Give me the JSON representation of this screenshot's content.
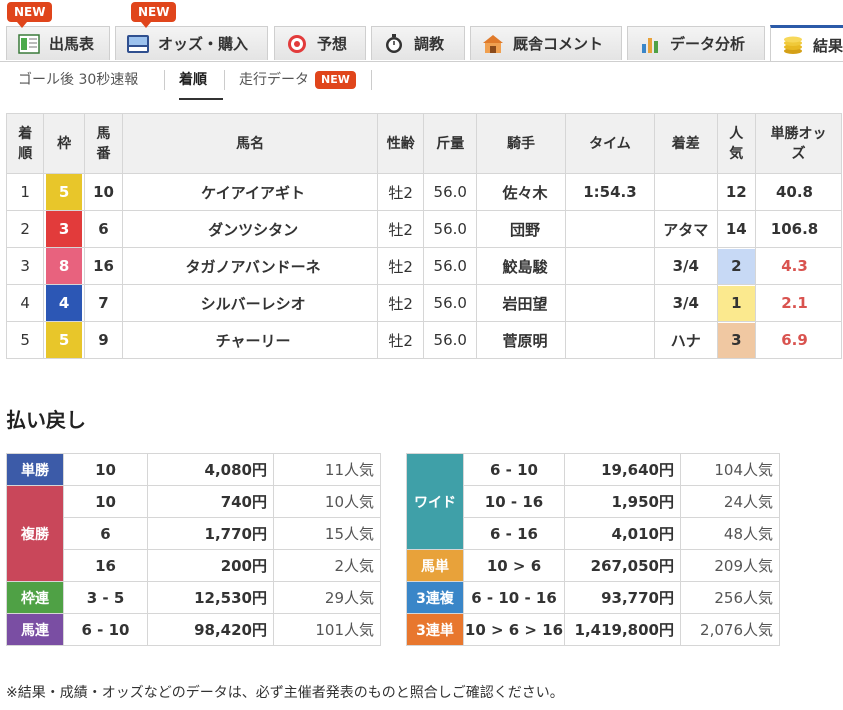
{
  "tabs": [
    {
      "label": "出馬表",
      "icon": "entries-table-icon",
      "new": true
    },
    {
      "label": "オッズ・購入",
      "icon": "ipat-odds-icon",
      "new": true
    },
    {
      "label": "予想",
      "icon": "target-icon",
      "new": false
    },
    {
      "label": "調教",
      "icon": "stopwatch-icon",
      "new": false
    },
    {
      "label": "厩舎コメント",
      "icon": "stable-icon",
      "new": false
    },
    {
      "label": "データ分析",
      "icon": "bar-chart-icon",
      "new": false
    },
    {
      "label": "結果",
      "icon": "coins-icon",
      "new": false,
      "active": true
    }
  ],
  "new_label": "NEW",
  "subnav": {
    "items": [
      "ゴール後 30秒速報",
      "着順",
      "走行データ"
    ],
    "active_index": 1,
    "new_on_index": 2
  },
  "results": {
    "headers": {
      "rank": "着順",
      "frame": "枠",
      "number": "馬番",
      "horse": "馬名",
      "sexage": "性齢",
      "weight": "斤量",
      "jockey": "騎手",
      "time": "タイム",
      "margin": "着差",
      "popularity": "人気",
      "odds": "単勝オッズ"
    },
    "rows": [
      {
        "rank": "1",
        "frame": "5",
        "frame_color": "#e8c62a",
        "number": "10",
        "horse": "ケイアイアギト",
        "sexage": "牡2",
        "weight": "56.0",
        "jockey": "佐々木",
        "time": "1:54.3",
        "margin": "",
        "popularity": "12",
        "pop_bg": "",
        "odds": "40.8",
        "odds_color": "#333333"
      },
      {
        "rank": "2",
        "frame": "3",
        "frame_color": "#e23b3b",
        "number": "6",
        "horse": "ダンツシタン",
        "sexage": "牡2",
        "weight": "56.0",
        "jockey": "団野",
        "time": "",
        "margin": "アタマ",
        "popularity": "14",
        "pop_bg": "",
        "odds": "106.8",
        "odds_color": "#333333"
      },
      {
        "rank": "3",
        "frame": "8",
        "frame_color": "#e8627e",
        "number": "16",
        "horse": "タガノアバンドーネ",
        "sexage": "牡2",
        "weight": "56.0",
        "jockey": "鮫島駿",
        "time": "",
        "margin": "3/4",
        "popularity": "2",
        "pop_bg": "#c7d9f5",
        "odds": "4.3",
        "odds_color": "#d9534f"
      },
      {
        "rank": "4",
        "frame": "4",
        "frame_color": "#2c57b5",
        "number": "7",
        "horse": "シルバーレシオ",
        "sexage": "牡2",
        "weight": "56.0",
        "jockey": "岩田望",
        "time": "",
        "margin": "3/4",
        "popularity": "1",
        "pop_bg": "#fbe98e",
        "odds": "2.1",
        "odds_color": "#d9534f"
      },
      {
        "rank": "5",
        "frame": "5",
        "frame_color": "#e8c62a",
        "number": "9",
        "horse": "チャーリー",
        "sexage": "牡2",
        "weight": "56.0",
        "jockey": "菅原明",
        "time": "",
        "margin": "ハナ",
        "popularity": "3",
        "pop_bg": "#f0c8a2",
        "odds": "6.9",
        "odds_color": "#d9534f"
      }
    ]
  },
  "payout": {
    "title": "払い戻し",
    "left": [
      {
        "label": "単勝",
        "color": "#3c5ba8",
        "entries": [
          {
            "combo": "10",
            "amount": "4,080円",
            "pop": "11人気"
          }
        ]
      },
      {
        "label": "複勝",
        "color": "#c9475a",
        "entries": [
          {
            "combo": "10",
            "amount": "740円",
            "pop": "10人気"
          },
          {
            "combo": "6",
            "amount": "1,770円",
            "pop": "15人気"
          },
          {
            "combo": "16",
            "amount": "200円",
            "pop": "2人気"
          }
        ]
      },
      {
        "label": "枠連",
        "color": "#4fa145",
        "entries": [
          {
            "combo": "3 - 5",
            "amount": "12,530円",
            "pop": "29人気"
          }
        ]
      },
      {
        "label": "馬連",
        "color": "#7a4ea3",
        "entries": [
          {
            "combo": "6 - 10",
            "amount": "98,420円",
            "pop": "101人気"
          }
        ]
      }
    ],
    "right": [
      {
        "label": "ワイド",
        "color": "#3fa0a8",
        "entries": [
          {
            "combo": "6 - 10",
            "amount": "19,640円",
            "pop": "104人気"
          },
          {
            "combo": "10 - 16",
            "amount": "1,950円",
            "pop": "24人気"
          },
          {
            "combo": "6 - 16",
            "amount": "4,010円",
            "pop": "48人気"
          }
        ]
      },
      {
        "label": "馬単",
        "color": "#e8a23a",
        "entries": [
          {
            "combo": "10 > 6",
            "amount": "267,050円",
            "pop": "209人気"
          }
        ]
      },
      {
        "label": "3連複",
        "color": "#3a86c8",
        "entries": [
          {
            "combo": "6 - 10 - 16",
            "amount": "93,770円",
            "pop": "256人気"
          }
        ]
      },
      {
        "label": "3連単",
        "color": "#e8772e",
        "entries": [
          {
            "combo": "10 > 6 > 16",
            "amount": "1,419,800円",
            "pop": "2,076人気"
          }
        ]
      }
    ]
  },
  "footnote": "※結果・成績・オッズなどのデータは、必ず主催者発表のものと照合しご確認ください。"
}
